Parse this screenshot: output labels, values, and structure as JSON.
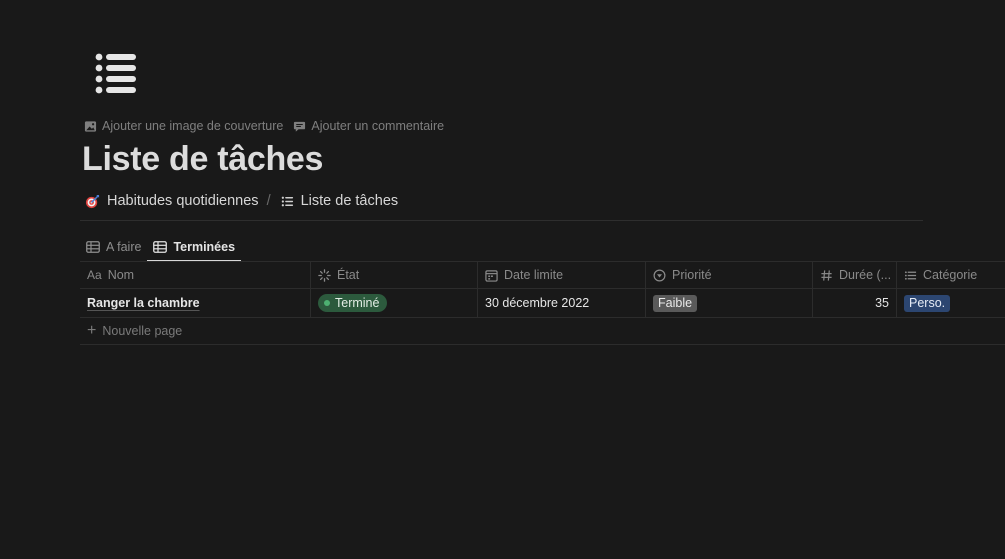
{
  "page": {
    "icon": "bulleted-list-icon",
    "title": "Liste de tâches",
    "actions": {
      "add_cover": "Ajouter une image de couverture",
      "add_comment": "Ajouter un commentaire"
    },
    "breadcrumb": {
      "parent": {
        "icon": "target-dart-emoji",
        "label": "Habitudes quotidiennes"
      },
      "separator": "/",
      "current": {
        "icon": "list-icon",
        "label": "Liste de tâches"
      }
    }
  },
  "views": [
    {
      "label": "A faire",
      "icon": "table-icon",
      "active": false
    },
    {
      "label": "Terminées",
      "icon": "table-icon",
      "active": true
    }
  ],
  "table": {
    "columns": {
      "nom": {
        "prefix": "Aa",
        "label": "Nom"
      },
      "etat": {
        "icon": "status-spinner-icon",
        "label": "État"
      },
      "date": {
        "icon": "calendar-icon",
        "label": "Date limite"
      },
      "priorite": {
        "icon": "select-circle-icon",
        "label": "Priorité"
      },
      "duree": {
        "icon": "hash-icon",
        "label": "Durée (..."
      },
      "categorie": {
        "icon": "multi-select-list-icon",
        "label": "Catégorie"
      }
    },
    "rows": [
      {
        "nom": "Ranger la chambre",
        "etat": "Terminé",
        "date": "30 décembre 2022",
        "priorite": "Faible",
        "duree": "35",
        "categorie": "Perso."
      }
    ],
    "new_page_label": "Nouvelle page"
  },
  "colors": {
    "background": "#191919",
    "status_done": "#2c5a3d",
    "tag_faible": "#5a5a5a",
    "tag_perso": "#2c4671"
  }
}
